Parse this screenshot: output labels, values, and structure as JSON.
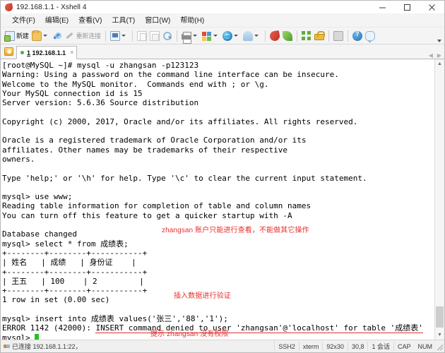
{
  "window": {
    "title": "192.168.1.1 - Xshell 4",
    "icon": "xshell-icon",
    "minimize": "─",
    "maximize": "□",
    "close": "✕"
  },
  "menubar": {
    "items": [
      {
        "label": "文件(F)",
        "name": "menu-file"
      },
      {
        "label": "编辑(E)",
        "name": "menu-edit"
      },
      {
        "label": "查看(V)",
        "name": "menu-view"
      },
      {
        "label": "工具(T)",
        "name": "menu-tools"
      },
      {
        "label": "窗口(W)",
        "name": "menu-window"
      },
      {
        "label": "帮助(H)",
        "name": "menu-help"
      }
    ]
  },
  "toolbar": {
    "new_label": "新建",
    "reconnect_label": "重新连接"
  },
  "tabbar": {
    "new_tab_icon": "new-session-icon",
    "tab": {
      "index": "1",
      "label": "192.168.1.1",
      "close": "×",
      "status": "connected"
    }
  },
  "terminal": {
    "lines": [
      "[root@MySQL ~]# mysql -u zhangsan -p123123",
      "Warning: Using a password on the command line interface can be insecure.",
      "Welcome to the MySQL monitor.  Commands end with ; or \\g.",
      "Your MySQL connection id is 15",
      "Server version: 5.6.36 Source distribution",
      "",
      "Copyright (c) 2000, 2017, Oracle and/or its affiliates. All rights reserved.",
      "",
      "Oracle is a registered trademark of Oracle Corporation and/or its",
      "affiliates. Other names may be trademarks of their respective",
      "owners.",
      "",
      "Type 'help;' or '\\h' for help. Type '\\c' to clear the current input statement.",
      "",
      "mysql> use www;",
      "Reading table information for completion of table and column names",
      "You can turn off this feature to get a quicker startup with -A",
      "",
      "Database changed",
      "mysql> select * from 成绩表;",
      "+--------+--------+-----------+",
      "| 姓名   | 成绩   | 身份证    |",
      "+--------+--------+-----------+",
      "| 王五   | 100    | 2         |",
      "+--------+--------+-----------+",
      "1 row in set (0.00 sec)",
      "",
      "mysql> insert into 成绩表 values('张三','88','1');"
    ],
    "error_prefix": "ERROR 1142 (42000): ",
    "error_body": "INSERT command denied to user 'zhangsan'@'localhost' for table '成绩表'",
    "prompt": "mysql> ",
    "annotations": [
      {
        "text": "zhangsan 账户只能进行查看，不能做其它操作",
        "name": "annotation-readonly"
      },
      {
        "text": "插入数据进行验证",
        "name": "annotation-insert-test"
      },
      {
        "text": "提示 zhangsan 没有权限",
        "name": "annotation-no-permission"
      }
    ],
    "annotation_color": "#e8302f",
    "text_color": "#000000",
    "cursor_color": "#22c51e",
    "background": "#ffffff"
  },
  "scrollbar": {
    "up_arrow": "▲",
    "down_arrow": "▼"
  },
  "statusbar": {
    "connection": "已连接 192.168.1.1:22，",
    "protocol": "SSH2",
    "terminal_type": "xterm",
    "size": "92x30",
    "cursor_pos": "30,8",
    "sessions": "1 会话",
    "caps": "CAP",
    "num": "NUM"
  }
}
